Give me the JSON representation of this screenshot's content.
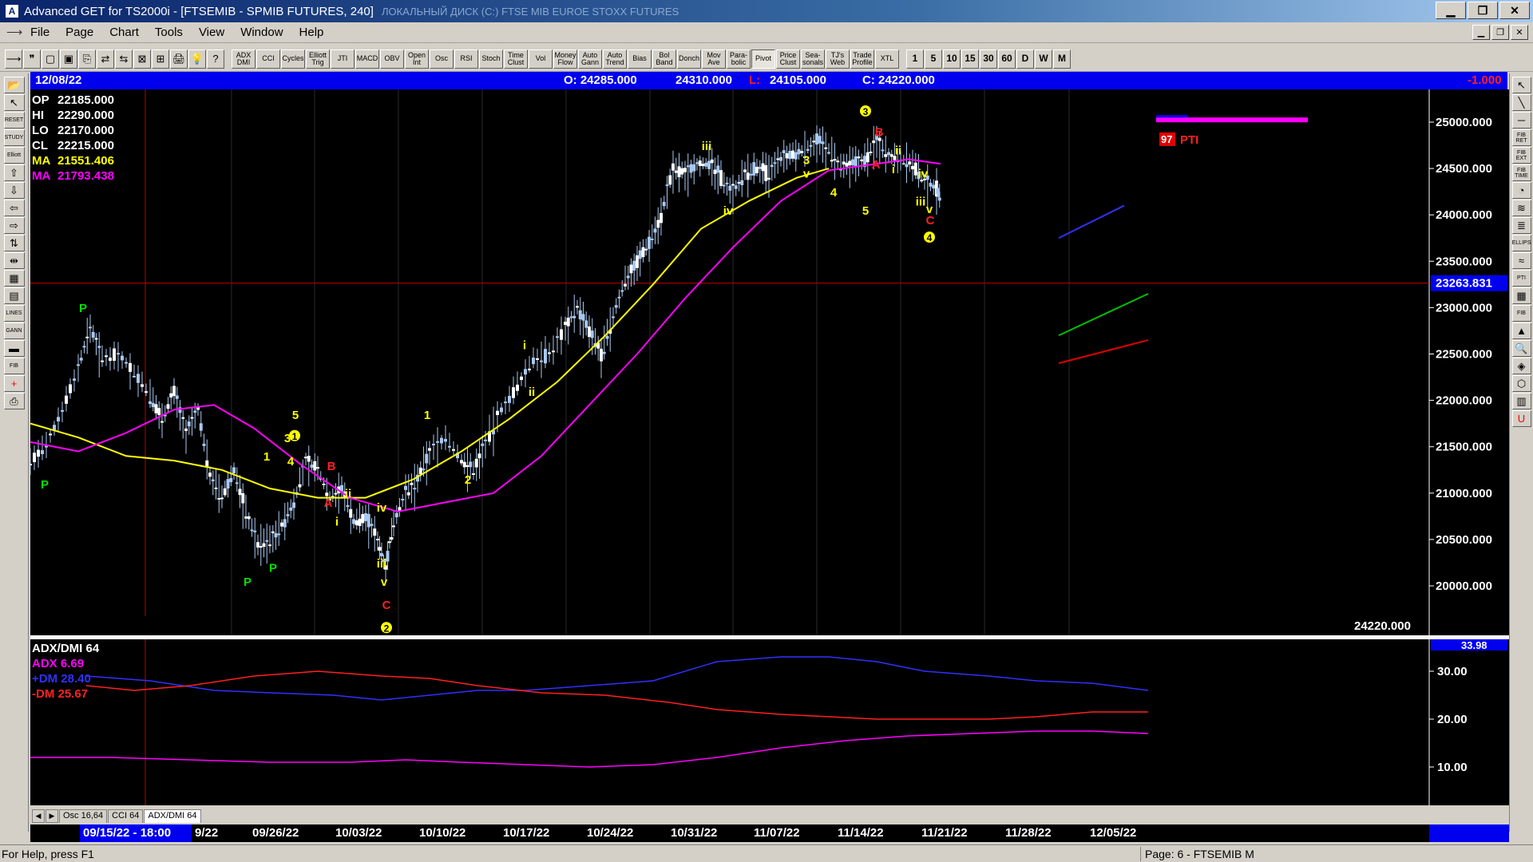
{
  "window": {
    "title": "Advanced GET for TS2000i - [FTSEMIB - SPMIB FUTURES, 240]",
    "ghost_title": "ЛОКАЛЬНЫЙ ДИСК (C:)    FTSE MIB    EUROE STOXX FUTURES",
    "controls": [
      "▁",
      "❐",
      "✕"
    ]
  },
  "menu": {
    "items": [
      "File",
      "Page",
      "Chart",
      "Tools",
      "View",
      "Window",
      "Help"
    ],
    "mdi_controls": [
      "▁",
      "❐",
      "✕"
    ]
  },
  "toolbar": {
    "icon_buttons": [
      "⟶",
      "❞",
      "▢",
      "▣",
      "⎘",
      "⇄",
      "⇆",
      "⊠",
      "⊞",
      "🖨",
      "💡",
      "?"
    ],
    "study_buttons": [
      "ADX DMI",
      "CCI",
      "Cycles",
      "Elliott Trig",
      "JTI",
      "MACD",
      "OBV",
      "Open Int",
      "Osc",
      "RSI",
      "Stoch",
      "Time Clust",
      "Vol",
      "Money Flow",
      "Auto Gann",
      "Auto Trend",
      "Bias",
      "Bol Band",
      "Donch",
      "Mov Ave",
      "Para-bolic",
      "Pivot",
      "Price Clust",
      "Sea-sonals",
      "TJ's Web",
      "Trade Profile",
      "XTL"
    ],
    "periods": [
      "1",
      "5",
      "10",
      "15",
      "30",
      "60",
      "D",
      "W",
      "M"
    ]
  },
  "left_tools": [
    "📂",
    "↖",
    "RESET",
    "STUDY",
    "Elliott",
    "⇧",
    "⇩",
    "⇦",
    "⇨",
    "⇅",
    "⇹",
    "▦",
    "▤",
    "LINES",
    "GANN",
    "▬",
    "FIB",
    "+",
    "⎙"
  ],
  "right_tools": [
    "↖",
    "╲",
    "─",
    "FIB RET",
    "FIB EXT",
    "FIB TIME",
    "◔",
    "≋",
    "≣",
    "ELLIPS",
    "≈",
    "PTI",
    "▦",
    "FIB",
    "▲",
    "🔍",
    "◈",
    "⬡",
    "▥",
    "U"
  ],
  "infobar": {
    "date": "12/08/22",
    "open": "O: 24285.000",
    "high": "24310.000",
    "low_label": "L:",
    "low": "24105.000",
    "close": "C: 24220.000",
    "change": "-1.000"
  },
  "ohlc": {
    "rows": [
      {
        "k": "OP",
        "v": "22185.000",
        "color": "#ffffff"
      },
      {
        "k": "HI",
        "v": "22290.000",
        "color": "#ffffff"
      },
      {
        "k": "LO",
        "v": "22170.000",
        "color": "#ffffff"
      },
      {
        "k": "CL",
        "v": "22215.000",
        "color": "#ffffff"
      },
      {
        "k": "MA",
        "v": "21551.406",
        "color": "#ffff00"
      },
      {
        "k": "MA",
        "v": "21793.438",
        "color": "#ff00ff"
      }
    ]
  },
  "price_axis": {
    "labels": [
      "25000.000",
      "24500.000",
      "24000.000",
      "23500.000",
      "23000.000",
      "22500.000",
      "22000.000",
      "21500.000",
      "21000.000",
      "20500.000",
      "20000.000"
    ],
    "cursor_price": "23263.831",
    "last_price": "24220.000"
  },
  "pti": {
    "value": "97",
    "label": "PTI"
  },
  "indicator": {
    "name": "ADX/DMI 64",
    "adx": "ADX 6.69",
    "plus_dm": "+DM 28.40",
    "minus_dm": "-DM  25.67",
    "axis_labels": [
      "30.00",
      "20.00",
      "10.00"
    ],
    "top_value": "33.98",
    "colors": {
      "adx": "#ff00ff",
      "plus_dm": "#3030ff",
      "minus_dm": "#ff2020"
    }
  },
  "tabs": {
    "arrows": [
      "◀",
      "▶"
    ],
    "items": [
      "Osc 16,64",
      "CCI 64",
      "ADX/DMI 64"
    ],
    "active": 2
  },
  "dates": {
    "cursor": "09/15/22 - 18:00",
    "leading": "0",
    "trailing": "9/22",
    "labels": [
      "09/26/22",
      "10/03/22",
      "10/10/22",
      "10/17/22",
      "10/24/22",
      "10/31/22",
      "11/07/22",
      "11/14/22",
      "11/21/22",
      "11/28/22",
      "12/05/22"
    ]
  },
  "elliott_labels": [
    {
      "t": "P",
      "c": "#00e000"
    },
    {
      "t": "P",
      "c": "#00e000"
    },
    {
      "t": "P",
      "c": "#00e000"
    },
    {
      "t": "1",
      "c": "#ffff00"
    },
    {
      "t": "2",
      "c": "#ffff00"
    },
    {
      "t": "3",
      "c": "#ffff00"
    },
    {
      "t": "4",
      "c": "#ffff00"
    },
    {
      "t": "5",
      "c": "#ffff00"
    },
    {
      "t": "A",
      "c": "#ff2020"
    },
    {
      "t": "B",
      "c": "#ff2020"
    },
    {
      "t": "C",
      "c": "#ff2020"
    },
    {
      "t": "i",
      "c": "#ffff00"
    },
    {
      "t": "ii",
      "c": "#ffff00"
    },
    {
      "t": "iii",
      "c": "#ffff00"
    },
    {
      "t": "iv",
      "c": "#ffff00"
    },
    {
      "t": "v",
      "c": "#ffff00"
    }
  ],
  "status": {
    "left": "For Help, press F1",
    "right": "Page: 6 - FTSEMIB M"
  },
  "colors": {
    "chart_bg": "#000000",
    "infobar_bg": "#0000ee",
    "ma_fast": "#ffff00",
    "ma_slow": "#ff00ff",
    "candles": "#a8c8f0",
    "cursor_line": "#c00000"
  }
}
